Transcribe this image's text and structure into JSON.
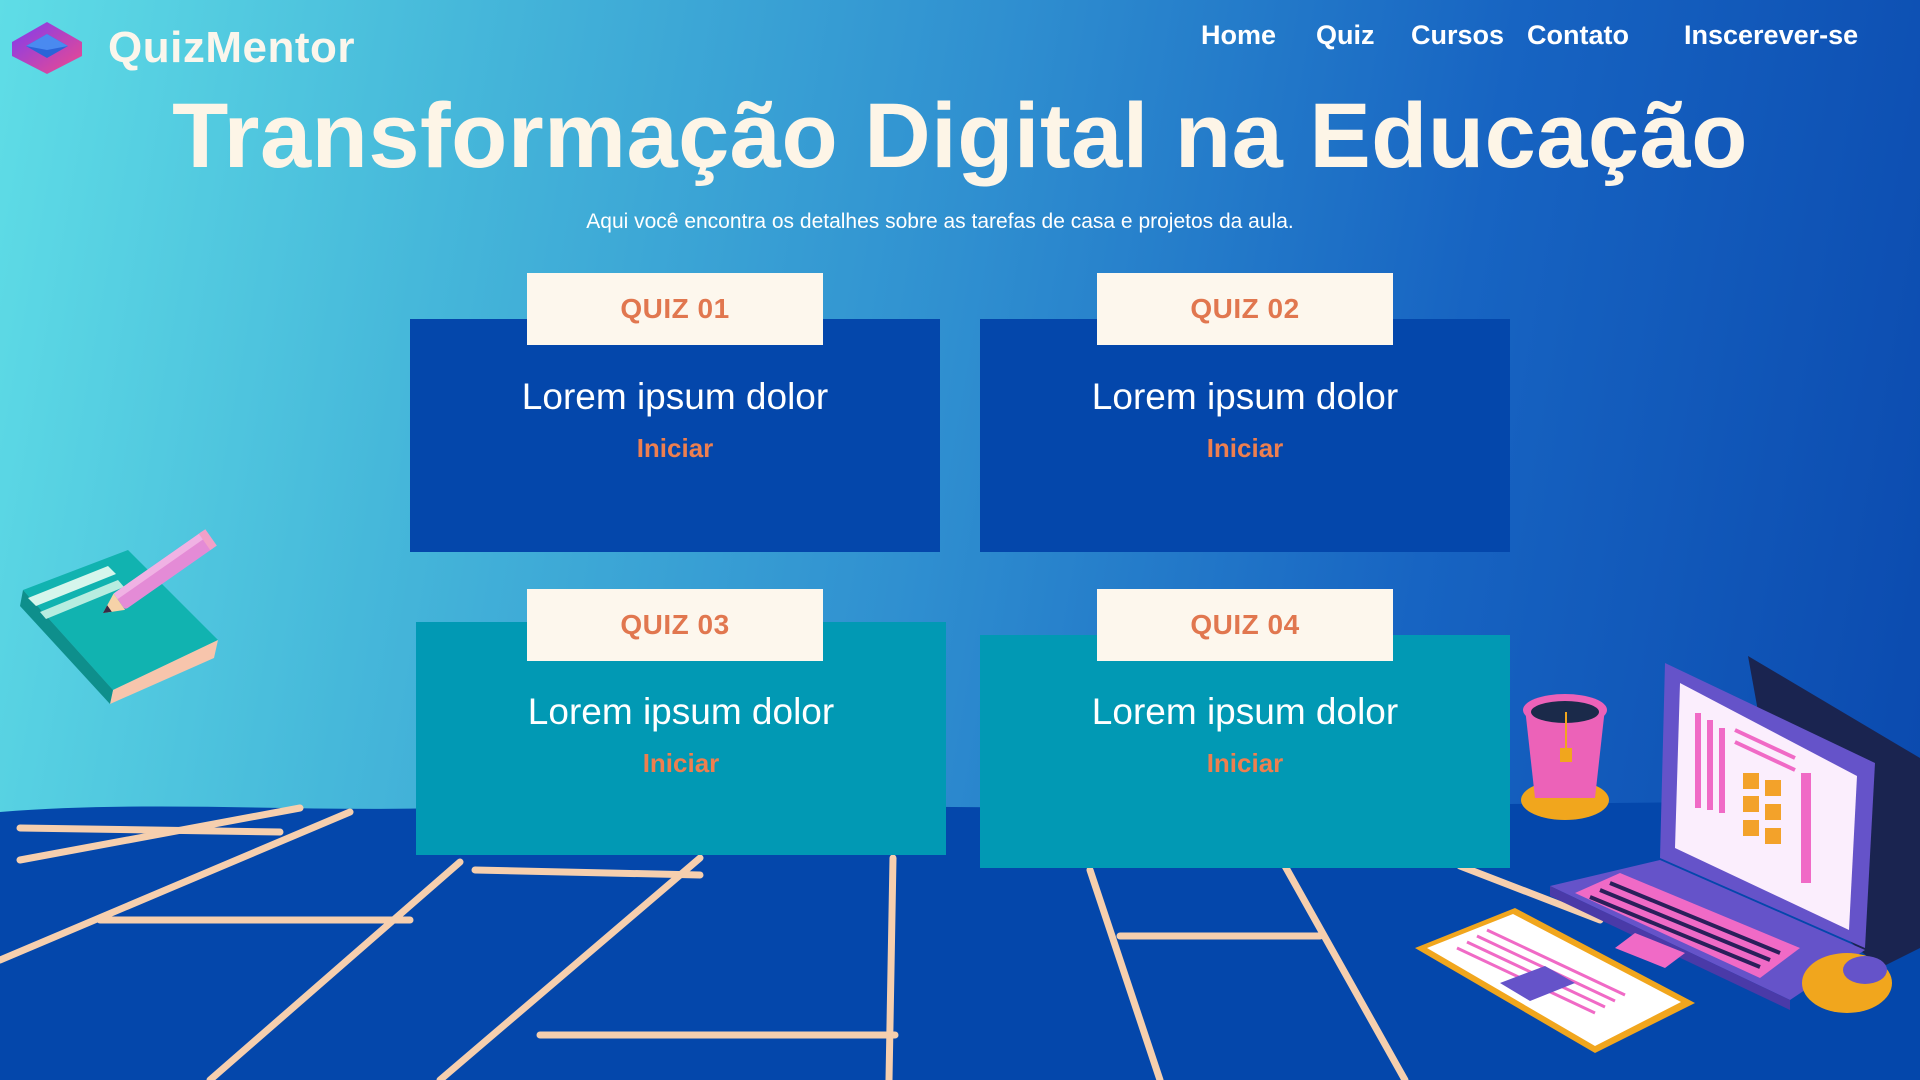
{
  "brand": {
    "name": "QuizMentor"
  },
  "nav": {
    "home": "Home",
    "quiz": "Quiz",
    "cursos": "Cursos",
    "contato": "Contato",
    "inscrever": "Inscerever-se"
  },
  "hero": {
    "title": "Transformação Digital na Educação",
    "subtitle": "Aqui você encontra os detalhes sobre as tarefas de casa e projetos da aula."
  },
  "quizzes": [
    {
      "tag": "QUIZ 01",
      "title": "Lorem ipsum dolor",
      "action": "Iniciar"
    },
    {
      "tag": "QUIZ 02",
      "title": "Lorem ipsum dolor",
      "action": "Iniciar"
    },
    {
      "tag": "QUIZ 03",
      "title": "Lorem ipsum dolor",
      "action": "Iniciar"
    },
    {
      "tag": "QUIZ 04",
      "title": "Lorem ipsum dolor",
      "action": "Iniciar"
    }
  ],
  "decorations": {
    "left": "book-pencil-illustration",
    "right": "laptop-cup-tablet-mouse-illustration"
  },
  "colors": {
    "card_blue": "#0447ab",
    "card_teal": "#0199b4",
    "tag_bg": "#fdf7ed",
    "accent_orange": "#e1774f",
    "title_cream": "#fdf5e7"
  }
}
